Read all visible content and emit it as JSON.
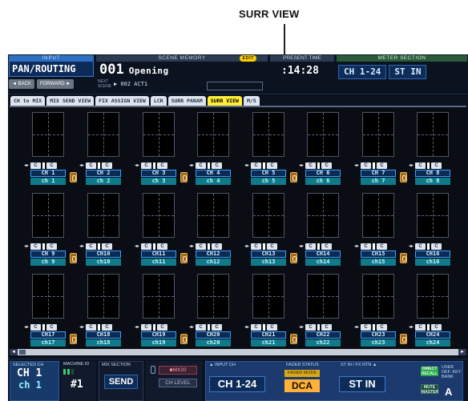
{
  "callout": {
    "label": "SURR VIEW"
  },
  "header": {
    "page_caption": "INPUT",
    "page_name": "PAN/ROUTING",
    "back_label": "◄ BACK",
    "forward_label": "FORWARD ►",
    "scene_caption": "SCENE MEMORY",
    "edit_badge": "EDIT",
    "scene_number": "001",
    "scene_title": "Opening",
    "next_caption": "NEXT SCENE",
    "next_scene": "▶ 002 ACT1",
    "time_caption": "PRESENT TIME",
    "time_value": ":14:28",
    "meter_caption": "METER SECTION",
    "meter_ch": "CH 1-24",
    "meter_st": "ST IN"
  },
  "tabs": [
    {
      "label": "CH to MIX",
      "active": false
    },
    {
      "label": "MIX SEND VIEW",
      "active": false
    },
    {
      "label": "FIX ASSIGN VIEW",
      "active": false
    },
    {
      "label": "LCR",
      "active": false
    },
    {
      "label": "SURR PARAM",
      "active": false
    },
    {
      "label": "SURR VIEW",
      "active": true
    },
    {
      "label": "M/S",
      "active": false
    }
  ],
  "pan_controls": {
    "c_label": "C"
  },
  "channels": [
    {
      "ch": "CH 1",
      "name": "ch 1"
    },
    {
      "ch": "CH 2",
      "name": "ch 2"
    },
    {
      "ch": "CH 3",
      "name": "ch 3"
    },
    {
      "ch": "CH 4",
      "name": "ch 4"
    },
    {
      "ch": "CH 5",
      "name": "ch 5"
    },
    {
      "ch": "CH 6",
      "name": "ch 6"
    },
    {
      "ch": "CH 7",
      "name": "ch 7"
    },
    {
      "ch": "CH 8",
      "name": "ch 8"
    },
    {
      "ch": "CH 9",
      "name": "ch 9"
    },
    {
      "ch": "CH10",
      "name": "ch10"
    },
    {
      "ch": "CH11",
      "name": "ch11"
    },
    {
      "ch": "CH12",
      "name": "ch12"
    },
    {
      "ch": "CH13",
      "name": "ch13"
    },
    {
      "ch": "CH14",
      "name": "ch14"
    },
    {
      "ch": "CH15",
      "name": "ch15"
    },
    {
      "ch": "CH16",
      "name": "ch16"
    },
    {
      "ch": "CH17",
      "name": "ch17"
    },
    {
      "ch": "CH18",
      "name": "ch18"
    },
    {
      "ch": "CH19",
      "name": "ch19"
    },
    {
      "ch": "CH20",
      "name": "ch20"
    },
    {
      "ch": "CH21",
      "name": "ch21"
    },
    {
      "ch": "CH22",
      "name": "ch22"
    },
    {
      "ch": "CH23",
      "name": "ch23"
    },
    {
      "ch": "CH24",
      "name": "ch24"
    }
  ],
  "footer": {
    "selected_caption": "SELECTED CH",
    "selected_ch": "CH 1",
    "selected_name": "ch 1",
    "machine_caption": "MACHINE ID",
    "machine_id": "#1",
    "mix_caption": "MIX SECTION",
    "mix_send": "SEND",
    "mix_tab_a": "■MX20",
    "mix_tab_b": "CH LEVEL",
    "inch_caption": "▲ INPUT CH",
    "fader_caption": "FADER STATUS",
    "stin_caption": "ST IN / FX RTN ▲",
    "inch_btn": "CH 1-24",
    "fader_mode": "FADER MODE",
    "dca_btn": "DCA",
    "stin_btn": "ST IN",
    "direct_recall": "DIRECT RECALL",
    "mute_master": "MUTE MASTER",
    "user_key_caption": "USER DEF. KEY BANK",
    "user_key_value": "A"
  }
}
